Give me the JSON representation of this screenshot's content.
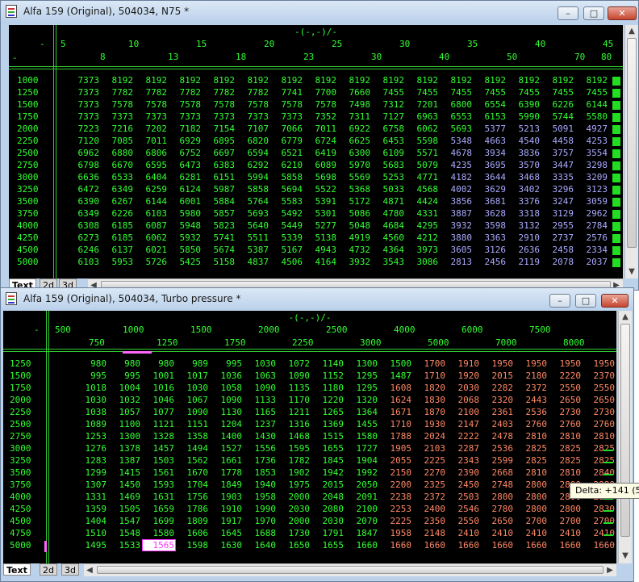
{
  "colors": {
    "cell_green": "#33ff33",
    "cell_purple": "#aaaaff",
    "cell_red": "#ff8866",
    "selected_text": "#ff33ff",
    "grid_line": "#33cc33"
  },
  "window1": {
    "title": "Alfa 159 (Original), 504034, N75 *",
    "header_title": "-(-,-)/-",
    "corner_top": "-",
    "corner_left": "-",
    "cols_top": [
      "5",
      "10",
      "15",
      "20",
      "25",
      "30",
      "35",
      "40",
      "45",
      "50",
      "55",
      "60",
      "65",
      "70",
      "75",
      "80"
    ],
    "cols_bottom": [
      "8",
      "13",
      "18",
      "23",
      "30",
      "40",
      "50",
      "70",
      "80"
    ],
    "rows": [
      "1000",
      "1250",
      "1500",
      "1750",
      "2000",
      "2250",
      "2500",
      "2750",
      "3000",
      "3250",
      "3500",
      "3750",
      "4000",
      "4250",
      "4500",
      "5000"
    ],
    "values": [
      [
        "7373",
        "8192",
        "8192",
        "8192",
        "8192",
        "8192",
        "8192",
        "8192",
        "8192",
        "8192",
        "8192",
        "8192",
        "8192",
        "8192",
        "8192",
        "8192"
      ],
      [
        "7373",
        "7782",
        "7782",
        "7782",
        "7782",
        "7782",
        "7741",
        "7700",
        "7660",
        "7455",
        "7455",
        "7455",
        "7455",
        "7455",
        "7455",
        "7455"
      ],
      [
        "7373",
        "7578",
        "7578",
        "7578",
        "7578",
        "7578",
        "7578",
        "7578",
        "7498",
        "7312",
        "7201",
        "6800",
        "6554",
        "6390",
        "6226",
        "6144"
      ],
      [
        "7373",
        "7373",
        "7373",
        "7373",
        "7373",
        "7373",
        "7373",
        "7352",
        "7311",
        "7127",
        "6963",
        "6553",
        "6153",
        "5990",
        "5744",
        "5580"
      ],
      [
        "7223",
        "7216",
        "7202",
        "7182",
        "7154",
        "7107",
        "7066",
        "7011",
        "6922",
        "6758",
        "6062",
        "5693",
        "5377",
        "5213",
        "5091",
        "4927"
      ],
      [
        "7120",
        "7085",
        "7011",
        "6929",
        "6895",
        "6820",
        "6779",
        "6724",
        "6625",
        "6453",
        "5598",
        "5348",
        "4663",
        "4540",
        "4458",
        "4253"
      ],
      [
        "6962",
        "6880",
        "6806",
        "6752",
        "6697",
        "6594",
        "6521",
        "6419",
        "6300",
        "6109",
        "5571",
        "4678",
        "3934",
        "3836",
        "3757",
        "3554"
      ],
      [
        "6798",
        "6670",
        "6595",
        "6473",
        "6383",
        "6292",
        "6210",
        "6089",
        "5970",
        "5683",
        "5079",
        "4235",
        "3695",
        "3570",
        "3447",
        "3298"
      ],
      [
        "6636",
        "6533",
        "6404",
        "6281",
        "6151",
        "5994",
        "5858",
        "5698",
        "5569",
        "5253",
        "4771",
        "4182",
        "3644",
        "3468",
        "3335",
        "3209"
      ],
      [
        "6472",
        "6349",
        "6259",
        "6124",
        "5987",
        "5858",
        "5694",
        "5522",
        "5368",
        "5033",
        "4568",
        "4002",
        "3629",
        "3402",
        "3296",
        "3123"
      ],
      [
        "6390",
        "6267",
        "6144",
        "6001",
        "5884",
        "5764",
        "5583",
        "5391",
        "5172",
        "4871",
        "4424",
        "3856",
        "3681",
        "3376",
        "3247",
        "3059"
      ],
      [
        "6349",
        "6226",
        "6103",
        "5980",
        "5857",
        "5693",
        "5492",
        "5301",
        "5086",
        "4780",
        "4331",
        "3887",
        "3628",
        "3318",
        "3129",
        "2962"
      ],
      [
        "6308",
        "6185",
        "6087",
        "5948",
        "5823",
        "5640",
        "5449",
        "5277",
        "5048",
        "4684",
        "4295",
        "3932",
        "3598",
        "3132",
        "2955",
        "2784"
      ],
      [
        "6273",
        "6185",
        "6062",
        "5932",
        "5741",
        "5511",
        "5339",
        "5138",
        "4919",
        "4560",
        "4212",
        "3880",
        "3363",
        "2910",
        "2737",
        "2576"
      ],
      [
        "6246",
        "6137",
        "6021",
        "5850",
        "5674",
        "5387",
        "5167",
        "4943",
        "4732",
        "4364",
        "3973",
        "3605",
        "3126",
        "2636",
        "2458",
        "2334"
      ],
      [
        "6103",
        "5953",
        "5726",
        "5425",
        "5158",
        "4837",
        "4506",
        "4164",
        "3932",
        "3543",
        "3086",
        "2813",
        "2456",
        "2119",
        "2078",
        "2037"
      ]
    ],
    "tabs": [
      "Text",
      "2d",
      "3d"
    ]
  },
  "window2": {
    "title": "Alfa 159 (Original), 504034, Turbo pressure *",
    "header_title": "-(-,-)/-",
    "corner_top": "-",
    "cols_top": [
      "500",
      "1000",
      "1500",
      "2000",
      "2500",
      "4000",
      "6000",
      "7500"
    ],
    "cols_bottom": [
      "750",
      "1250",
      "1750",
      "2250",
      "3000",
      "5000",
      "7000",
      "8000"
    ],
    "rows": [
      "1250",
      "1500",
      "1750",
      "2000",
      "2250",
      "2500",
      "2750",
      "3000",
      "3250",
      "3500",
      "3750",
      "4000",
      "4250",
      "4500",
      "4750",
      "5000"
    ],
    "values": [
      [
        "980",
        "980",
        "980",
        "989",
        "995",
        "1030",
        "1072",
        "1140",
        "1300",
        "1500",
        "1700",
        "1910",
        "1950",
        "1950",
        "1950",
        "1950"
      ],
      [
        "995",
        "995",
        "1001",
        "1017",
        "1036",
        "1063",
        "1090",
        "1152",
        "1295",
        "1487",
        "1710",
        "1920",
        "2015",
        "2180",
        "2220",
        "2370"
      ],
      [
        "1018",
        "1004",
        "1016",
        "1030",
        "1058",
        "1090",
        "1135",
        "1180",
        "1295",
        "1608",
        "1820",
        "2030",
        "2282",
        "2372",
        "2550",
        "2550"
      ],
      [
        "1030",
        "1032",
        "1046",
        "1067",
        "1090",
        "1133",
        "1170",
        "1220",
        "1320",
        "1624",
        "1830",
        "2068",
        "2320",
        "2443",
        "2650",
        "2650"
      ],
      [
        "1038",
        "1057",
        "1077",
        "1090",
        "1130",
        "1165",
        "1211",
        "1265",
        "1364",
        "1671",
        "1870",
        "2100",
        "2361",
        "2536",
        "2730",
        "2730"
      ],
      [
        "1089",
        "1100",
        "1121",
        "1151",
        "1204",
        "1237",
        "1316",
        "1369",
        "1455",
        "1710",
        "1930",
        "2147",
        "2403",
        "2760",
        "2760",
        "2760"
      ],
      [
        "1253",
        "1300",
        "1328",
        "1358",
        "1400",
        "1430",
        "1468",
        "1515",
        "1580",
        "1788",
        "2024",
        "2222",
        "2478",
        "2810",
        "2810",
        "2810"
      ],
      [
        "1276",
        "1378",
        "1457",
        "1494",
        "1527",
        "1556",
        "1595",
        "1655",
        "1727",
        "1905",
        "2103",
        "2287",
        "2536",
        "2825",
        "2825",
        "2825"
      ],
      [
        "1283",
        "1387",
        "1503",
        "1562",
        "1661",
        "1736",
        "1782",
        "1845",
        "1904",
        "2055",
        "2225",
        "2343",
        "2599",
        "2825",
        "2825",
        "2825"
      ],
      [
        "1299",
        "1415",
        "1561",
        "1670",
        "1778",
        "1853",
        "1902",
        "1942",
        "1992",
        "2150",
        "2270",
        "2390",
        "2668",
        "2810",
        "2810",
        "2840"
      ],
      [
        "1307",
        "1450",
        "1593",
        "1704",
        "1849",
        "1940",
        "1975",
        "2015",
        "2050",
        "2200",
        "2325",
        "2450",
        "2748",
        "2800",
        "2800",
        "2880"
      ],
      [
        "1331",
        "1469",
        "1631",
        "1756",
        "1903",
        "1958",
        "2000",
        "2048",
        "2091",
        "2238",
        "2372",
        "2503",
        "2800",
        "2800",
        "2800",
        "2850"
      ],
      [
        "1359",
        "1505",
        "1659",
        "1786",
        "1910",
        "1990",
        "2030",
        "2080",
        "2100",
        "2253",
        "2400",
        "2546",
        "2780",
        "2800",
        "2800",
        "2830"
      ],
      [
        "1404",
        "1547",
        "1699",
        "1809",
        "1917",
        "1970",
        "2000",
        "2030",
        "2070",
        "2225",
        "2350",
        "2550",
        "2650",
        "2700",
        "2700",
        "2700"
      ],
      [
        "1510",
        "1548",
        "1580",
        "1606",
        "1645",
        "1688",
        "1730",
        "1791",
        "1847",
        "1958",
        "2148",
        "2410",
        "2410",
        "2410",
        "2410",
        "2410"
      ],
      [
        "1495",
        "1533",
        "1565",
        "1598",
        "1630",
        "1640",
        "1650",
        "1655",
        "1660",
        "1660",
        "1660",
        "1660",
        "1660",
        "1660",
        "1660",
        "1660"
      ]
    ],
    "tabs": [
      "Text",
      "2d",
      "3d"
    ],
    "tooltip": "Delta: +141 (5.2"
  }
}
